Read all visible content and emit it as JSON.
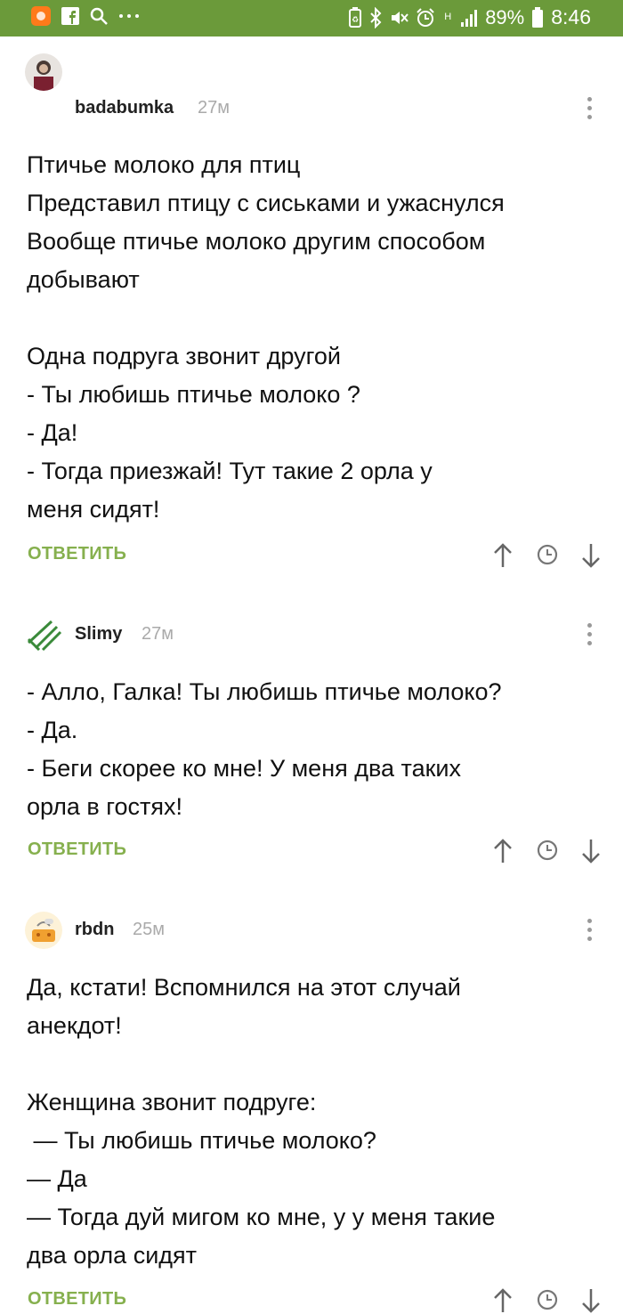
{
  "status_bar": {
    "battery": "89%",
    "time": "8:46",
    "signal_label": "H"
  },
  "comments": [
    {
      "user": "badabumka",
      "time": "27м",
      "lines": [
        "Птичье молоко для птиц",
        "Представил птицу с сиськами и ужаснулся",
        "Вообще птичье молоко другим способом",
        "добывают",
        "",
        "Одна подруга звонит другой",
        "- Ты любишь птичье молоко ?",
        "- Да!",
        "- Тогда приезжай! Тут такие 2 орла у",
        "меня сидят!"
      ],
      "reply_label": "ОТВЕТИТЬ"
    },
    {
      "user": "Slimy",
      "time": "27м",
      "lines": [
        "- Алло, Галка! Ты любишь птичье молоко?",
        "- Да.",
        "- Беги скорее ко мне! У меня два таких",
        "орла в гостях!"
      ],
      "reply_label": "ОТВЕТИТЬ"
    },
    {
      "user": "rbdn",
      "time": "25м",
      "lines": [
        "Да, кстати! Вспомнился на этот случай",
        "анекдот!",
        "",
        "Женщина звонит подруге:",
        " — Ты любишь птичье молоко?",
        "— Да",
        "— Тогда дуй мигом ко мне, у у меня такие",
        "два орла сидят"
      ],
      "reply_label": "ОТВЕТИТЬ"
    }
  ],
  "colors": {
    "status_bar": "#6b9a3a",
    "reply": "#86b04e",
    "meta": "#aaaaaa"
  }
}
